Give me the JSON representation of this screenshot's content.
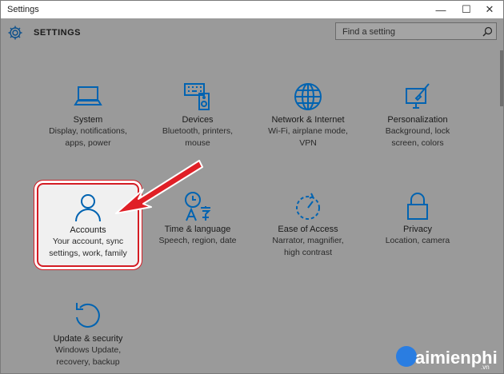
{
  "window": {
    "title": "Settings",
    "minimize": "—",
    "maximize": "☐",
    "close": "✕"
  },
  "header": {
    "heading": "SETTINGS",
    "search_placeholder": "Find a setting"
  },
  "tiles": [
    {
      "label": "System",
      "desc1": "Display, notifications,",
      "desc2": "apps, power",
      "desc3": ""
    },
    {
      "label": "Devices",
      "desc1": "Bluetooth, printers,",
      "desc2": "mouse",
      "desc3": ""
    },
    {
      "label": "Network & Internet",
      "desc1": "Wi-Fi, airplane mode,",
      "desc2": "VPN",
      "desc3": ""
    },
    {
      "label": "Personalization",
      "desc1": "Background, lock",
      "desc2": "screen, colors",
      "desc3": ""
    },
    {
      "label": "Accounts",
      "desc1": "Your account, sync",
      "desc2": "settings, work, family",
      "desc3": ""
    },
    {
      "label": "Time & language",
      "desc1": "Speech, region, date",
      "desc2": "",
      "desc3": ""
    },
    {
      "label": "Ease of Access",
      "desc1": "Narrator, magnifier,",
      "desc2": "high contrast",
      "desc3": ""
    },
    {
      "label": "Privacy",
      "desc1": "Location, camera",
      "desc2": "",
      "desc3": ""
    },
    {
      "label": "Update & security",
      "desc1": "Windows Update,",
      "desc2": "recovery, backup",
      "desc3": ""
    }
  ],
  "watermark": {
    "brand": "aimienphi",
    "tld": ".vn"
  },
  "colors": {
    "accent": "#0063b1",
    "highlight_border": "#d41c24",
    "arrow": "#e01f26"
  }
}
